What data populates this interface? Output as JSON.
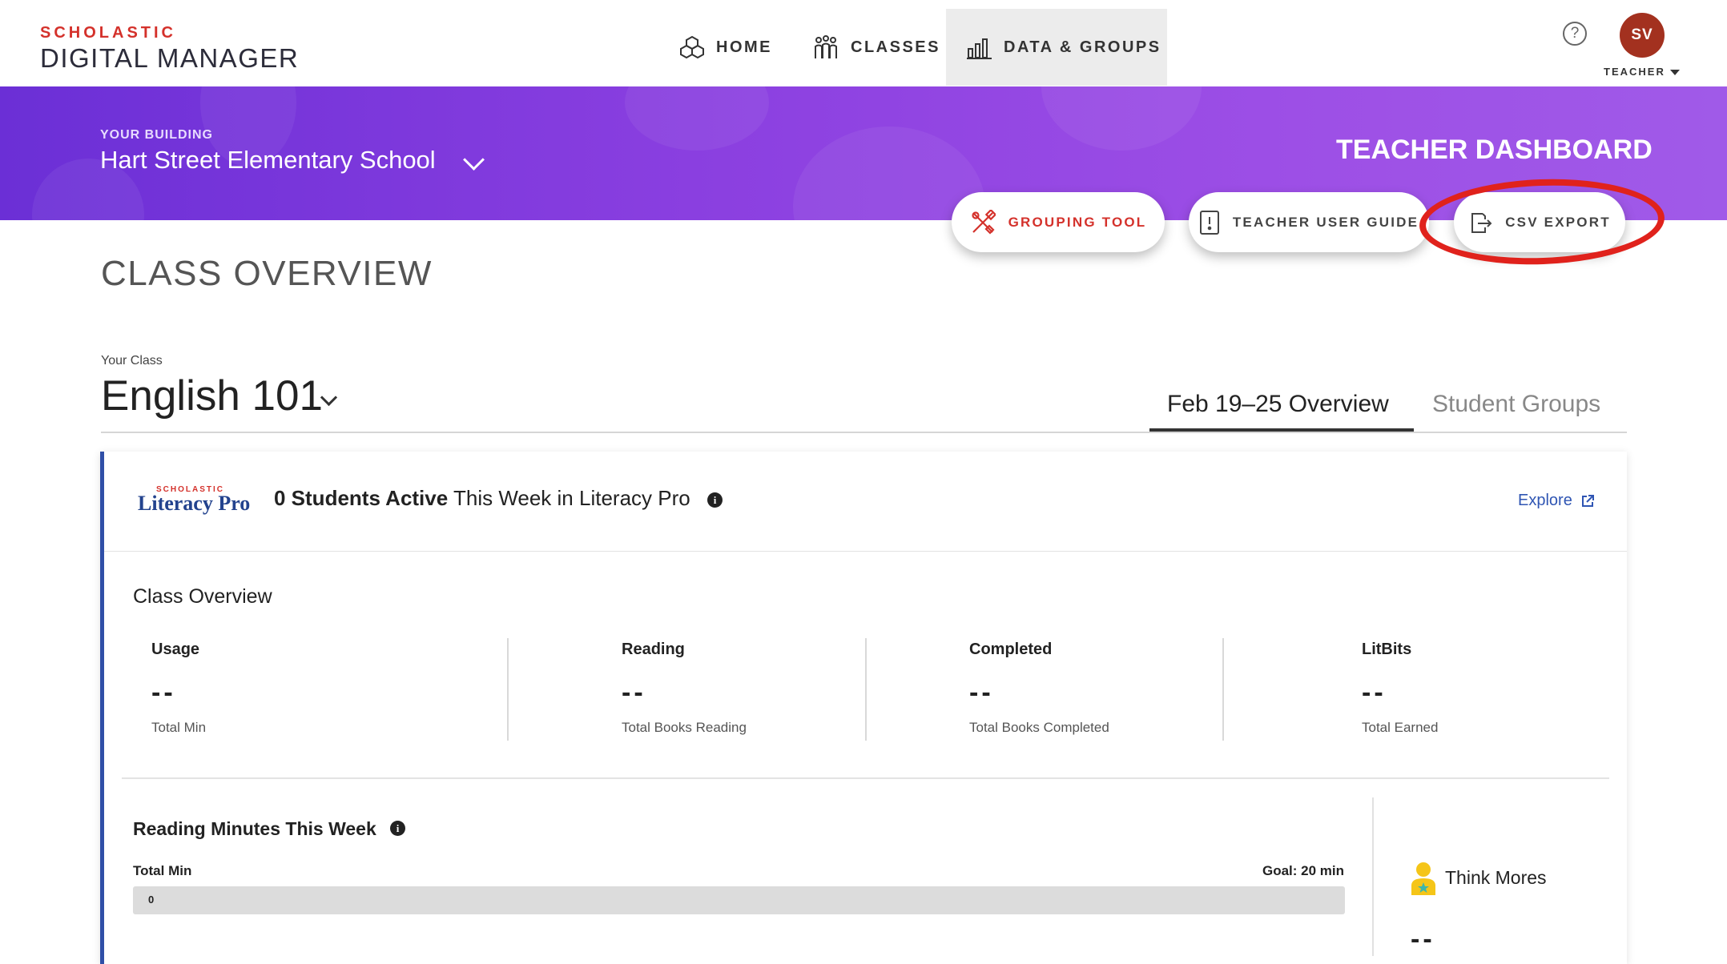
{
  "brand": {
    "top": "SCHOLASTIC",
    "main": "DIGITAL MANAGER"
  },
  "nav": {
    "home": "HOME",
    "classes": "CLASSES",
    "data_groups": "DATA & GROUPS"
  },
  "user": {
    "help": "?",
    "initials": "SV",
    "role": "TEACHER"
  },
  "banner": {
    "building_label": "YOUR BUILDING",
    "building_name": "Hart Street Elementary School",
    "dashboard_title": "TEACHER DASHBOARD"
  },
  "actions": {
    "grouping_tool": "GROUPING TOOL",
    "teacher_user_guide": "TEACHER USER GUIDE",
    "csv_export": "CSV EXPORT"
  },
  "page": {
    "title": "CLASS OVERVIEW",
    "your_class_label": "Your Class",
    "class_name": "English 101"
  },
  "tabs": [
    {
      "label": "Feb 19–25 Overview",
      "active": true
    },
    {
      "label": "Student Groups",
      "active": false
    }
  ],
  "card": {
    "logo_small": "SCHOLASTIC",
    "logo": "Literacy Pro",
    "active_bold": "0 Students Active",
    "active_rest": " This Week in Literacy Pro",
    "explore": "Explore",
    "overview_title": "Class Overview",
    "stats": [
      {
        "label": "Usage",
        "value": "--",
        "sub": "Total Min"
      },
      {
        "label": "Reading",
        "value": "--",
        "sub": "Total Books Reading"
      },
      {
        "label": "Completed",
        "value": "--",
        "sub": "Total Books Completed"
      },
      {
        "label": "LitBits",
        "value": "--",
        "sub": "Total Earned"
      }
    ],
    "reading_minutes": {
      "title": "Reading Minutes This Week",
      "total_label": "Total Min",
      "goal_label": "Goal: 20 min",
      "bar_value": "0"
    },
    "think_mores": {
      "label": "Think Mores",
      "value": "--"
    }
  },
  "colors": {
    "brand_red": "#d4312b",
    "banner_purple": "#7a37dc",
    "callout_red": "#e0221c",
    "link_blue": "#2f55b3",
    "avatar": "#a3311f"
  }
}
